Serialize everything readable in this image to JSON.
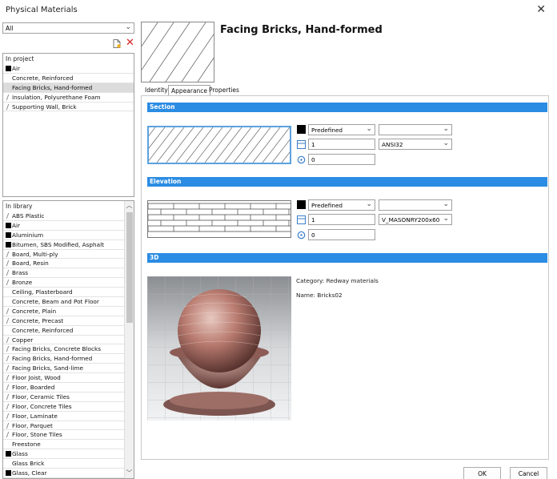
{
  "window": {
    "title": "Physical Materials"
  },
  "filter": {
    "value": "All"
  },
  "project_list": {
    "header": "In project",
    "items": [
      {
        "label": "Air",
        "swatch": "black"
      },
      {
        "label": "Concrete, Reinforced",
        "swatch": "none"
      },
      {
        "label": "Facing Bricks, Hand-formed",
        "swatch": "none",
        "selected": true
      },
      {
        "label": "Insulation, Polyurethane Foam",
        "swatch": "hatch"
      },
      {
        "label": "Supporting Wall, Brick",
        "swatch": "hatch"
      }
    ]
  },
  "library_list": {
    "header": "In library",
    "items": [
      {
        "label": "ABS Plastic",
        "swatch": "hatch"
      },
      {
        "label": "Air",
        "swatch": "black"
      },
      {
        "label": "Aluminium",
        "swatch": "black"
      },
      {
        "label": "Bitumen, SBS Modified, Asphalt",
        "swatch": "black"
      },
      {
        "label": "Board, Multi-ply",
        "swatch": "hatch"
      },
      {
        "label": "Board, Resin",
        "swatch": "hatch"
      },
      {
        "label": "Brass",
        "swatch": "hatch"
      },
      {
        "label": "Bronze",
        "swatch": "hatch"
      },
      {
        "label": "Ceiling, Plasterboard",
        "swatch": "none"
      },
      {
        "label": "Concrete, Beam and Pot Floor",
        "swatch": "none"
      },
      {
        "label": "Concrete, Plain",
        "swatch": "hatch"
      },
      {
        "label": "Concrete, Precast",
        "swatch": "hatch"
      },
      {
        "label": "Concrete, Reinforced",
        "swatch": "none"
      },
      {
        "label": "Copper",
        "swatch": "hatch"
      },
      {
        "label": "Facing Bricks, Concrete Blocks",
        "swatch": "hatch"
      },
      {
        "label": "Facing Bricks, Hand-formed",
        "swatch": "hatch"
      },
      {
        "label": "Facing Bricks, Sand-lime",
        "swatch": "hatch"
      },
      {
        "label": "Floor Joist, Wood",
        "swatch": "hatch"
      },
      {
        "label": "Floor, Boarded",
        "swatch": "hatch"
      },
      {
        "label": "Floor, Ceramic Tiles",
        "swatch": "hatch"
      },
      {
        "label": "Floor, Concrete Tiles",
        "swatch": "hatch"
      },
      {
        "label": "Floor, Laminate",
        "swatch": "hatch"
      },
      {
        "label": "Floor, Parquet",
        "swatch": "hatch"
      },
      {
        "label": "Floor, Stone Tiles",
        "swatch": "hatch"
      },
      {
        "label": "Freestone",
        "swatch": "none"
      },
      {
        "label": "Glass",
        "swatch": "black"
      },
      {
        "label": "Glass Brick",
        "swatch": "none"
      },
      {
        "label": "Glass, Clear",
        "swatch": "black"
      }
    ]
  },
  "material": {
    "title": "Facing Bricks, Hand-formed"
  },
  "tabs": [
    {
      "label": "Identity",
      "active": false
    },
    {
      "label": "Appearance",
      "active": true
    },
    {
      "label": "Properties",
      "active": false
    }
  ],
  "section": {
    "bar_label": "Section",
    "type": "Predefined",
    "color_combo": "",
    "scale": "1",
    "pattern": "ANSI32",
    "angle": "0"
  },
  "elevation": {
    "bar_label": "Elevation",
    "type": "Predefined",
    "color_combo": "",
    "scale": "1",
    "pattern": "V_MASONRY200x60",
    "angle": "0"
  },
  "render3d": {
    "bar_label": "3D",
    "category_label": "Category:",
    "category_value": "Redway materials",
    "name_label": "Name:",
    "name_value": "Bricks02"
  },
  "buttons": {
    "ok": "OK",
    "cancel": "Cancel"
  },
  "colors": {
    "accent_bar": "#2b8ce3",
    "selection": "#dcdcdc",
    "delete": "#d32020"
  }
}
